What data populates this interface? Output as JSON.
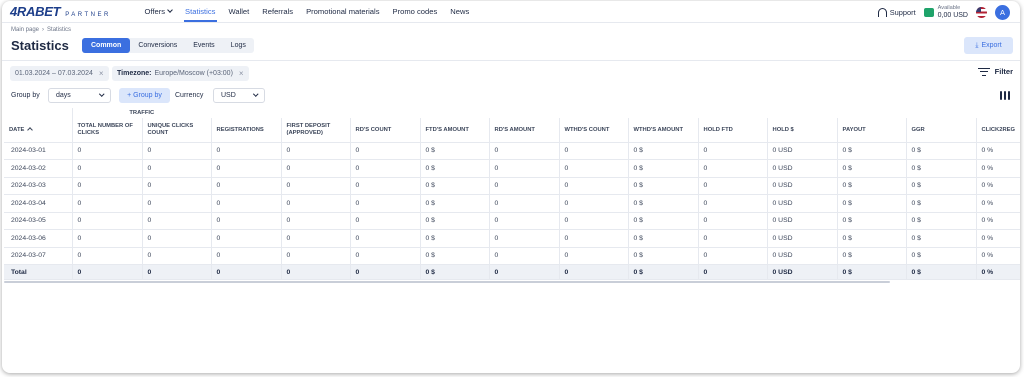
{
  "brand": {
    "logo": "4RABET",
    "sub": "PARTNER"
  },
  "nav": {
    "items": [
      {
        "label": "Offers",
        "dropdown": true
      },
      {
        "label": "Statistics",
        "active": true
      },
      {
        "label": "Wallet"
      },
      {
        "label": "Referrals"
      },
      {
        "label": "Promotional materials"
      },
      {
        "label": "Promo codes"
      },
      {
        "label": "News"
      }
    ],
    "support": "Support",
    "balance_label": "Available",
    "balance_value": "0,00 USD",
    "avatar": "A"
  },
  "breadcrumb": {
    "home": "Main page",
    "current": "Statistics"
  },
  "page_title": "Statistics",
  "tabs": [
    "Common",
    "Conversions",
    "Events",
    "Logs"
  ],
  "export_label": "Export",
  "filters": {
    "date_range": "01.03.2024 – 07.03.2024",
    "timezone_label": "Timezone:",
    "timezone_value": "Europe/Moscow (+03:00)",
    "filter_label": "Filter"
  },
  "controls": {
    "group_by_label": "Group by",
    "group_by_value": "days",
    "group_by_button": "+ Group by",
    "currency_label": "Currency",
    "currency_value": "USD"
  },
  "table": {
    "group_header": "TRAFFIC",
    "columns": [
      "DATE",
      "TOTAL NUMBER OF CLICKS",
      "UNIQUE CLICKS COUNT",
      "REGISTRATIONS",
      "FIRST DEPOSIT (APPROVED)",
      "RD'S COUNT",
      "FTD'S AMOUNT",
      "RD'S AMOUNT",
      "WTHD'S COUNT",
      "WTHD'S AMOUNT",
      "HOLD FTD",
      "HOLD $",
      "PAYOUT",
      "GGR",
      "CLICK2REG"
    ],
    "rows": [
      [
        "2024-03-01",
        "0",
        "0",
        "0",
        "0",
        "0",
        "0 $",
        "0",
        "0",
        "0 $",
        "0",
        "0 USD",
        "0 $",
        "0 $",
        "0 %"
      ],
      [
        "2024-03-02",
        "0",
        "0",
        "0",
        "0",
        "0",
        "0 $",
        "0",
        "0",
        "0 $",
        "0",
        "0 USD",
        "0 $",
        "0 $",
        "0 %"
      ],
      [
        "2024-03-03",
        "0",
        "0",
        "0",
        "0",
        "0",
        "0 $",
        "0",
        "0",
        "0 $",
        "0",
        "0 USD",
        "0 $",
        "0 $",
        "0 %"
      ],
      [
        "2024-03-04",
        "0",
        "0",
        "0",
        "0",
        "0",
        "0 $",
        "0",
        "0",
        "0 $",
        "0",
        "0 USD",
        "0 $",
        "0 $",
        "0 %"
      ],
      [
        "2024-03-05",
        "0",
        "0",
        "0",
        "0",
        "0",
        "0 $",
        "0",
        "0",
        "0 $",
        "0",
        "0 USD",
        "0 $",
        "0 $",
        "0 %"
      ],
      [
        "2024-03-06",
        "0",
        "0",
        "0",
        "0",
        "0",
        "0 $",
        "0",
        "0",
        "0 $",
        "0",
        "0 USD",
        "0 $",
        "0 $",
        "0 %"
      ],
      [
        "2024-03-07",
        "0",
        "0",
        "0",
        "0",
        "0",
        "0 $",
        "0",
        "0",
        "0 $",
        "0",
        "0 USD",
        "0 $",
        "0 $",
        "0 %"
      ]
    ],
    "total": [
      "Total",
      "0",
      "0",
      "0",
      "0",
      "0",
      "0 $",
      "0",
      "0",
      "0 $",
      "0",
      "0 USD",
      "0 $",
      "0 $",
      "0 %"
    ]
  },
  "colors": {
    "accent": "#3b6fe0",
    "accent_light": "#dbe6fb",
    "brand": "#1d3e8a",
    "wallet": "#1fa36a"
  }
}
